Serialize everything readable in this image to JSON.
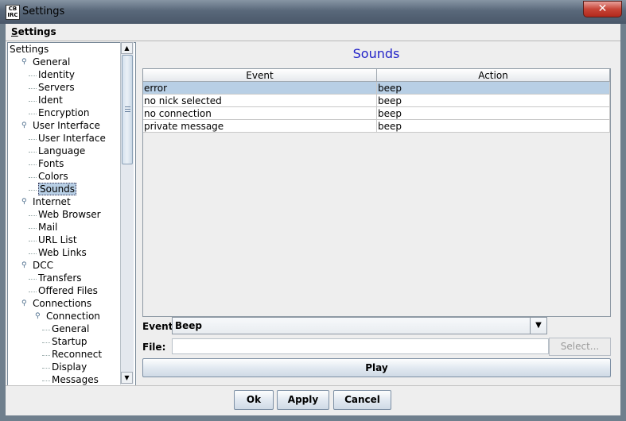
{
  "window": {
    "title": "Settings",
    "icon_text": "CB IRC",
    "close_glyph": "✕"
  },
  "menubar": {
    "items": [
      "Settings"
    ]
  },
  "tree": {
    "root": "Settings",
    "items": [
      {
        "label": "General",
        "level": 1,
        "expandable": true
      },
      {
        "label": "Identity",
        "level": 2
      },
      {
        "label": "Servers",
        "level": 2
      },
      {
        "label": "Ident",
        "level": 2
      },
      {
        "label": "Encryption",
        "level": 2
      },
      {
        "label": "User Interface",
        "level": 1,
        "expandable": true
      },
      {
        "label": "User Interface",
        "level": 2
      },
      {
        "label": "Language",
        "level": 2
      },
      {
        "label": "Fonts",
        "level": 2
      },
      {
        "label": "Colors",
        "level": 2
      },
      {
        "label": "Sounds",
        "level": 2,
        "selected": true
      },
      {
        "label": "Internet",
        "level": 1,
        "expandable": true
      },
      {
        "label": "Web Browser",
        "level": 2
      },
      {
        "label": "Mail",
        "level": 2
      },
      {
        "label": "URL List",
        "level": 2
      },
      {
        "label": "Web Links",
        "level": 2
      },
      {
        "label": "DCC",
        "level": 1,
        "expandable": true
      },
      {
        "label": "Transfers",
        "level": 2
      },
      {
        "label": "Offered Files",
        "level": 2
      },
      {
        "label": "Connections",
        "level": 1,
        "expandable": true
      },
      {
        "label": "Connection",
        "level": 2,
        "expandable": true
      },
      {
        "label": "General",
        "level": 3
      },
      {
        "label": "Startup",
        "level": 3
      },
      {
        "label": "Reconnect",
        "level": 3
      },
      {
        "label": "Display",
        "level": 3
      },
      {
        "label": "Messages",
        "level": 3
      }
    ]
  },
  "panel": {
    "title": "Sounds",
    "table": {
      "columns": [
        "Event",
        "Action"
      ],
      "rows": [
        [
          "error",
          "beep"
        ],
        [
          "no nick selected",
          "beep"
        ],
        [
          "no connection",
          "beep"
        ],
        [
          "private message",
          "beep"
        ]
      ],
      "selected_row": 0
    },
    "event_label": "Event:",
    "event_value": "Beep",
    "file_label": "File:",
    "file_value": "",
    "select_label": "Select...",
    "play_label": "Play"
  },
  "buttons": {
    "ok": "Ok",
    "apply": "Apply",
    "cancel": "Cancel"
  },
  "colors": {
    "title_accent": "#2323c8",
    "selection": "#b8cfe5",
    "close": "#c74537"
  }
}
